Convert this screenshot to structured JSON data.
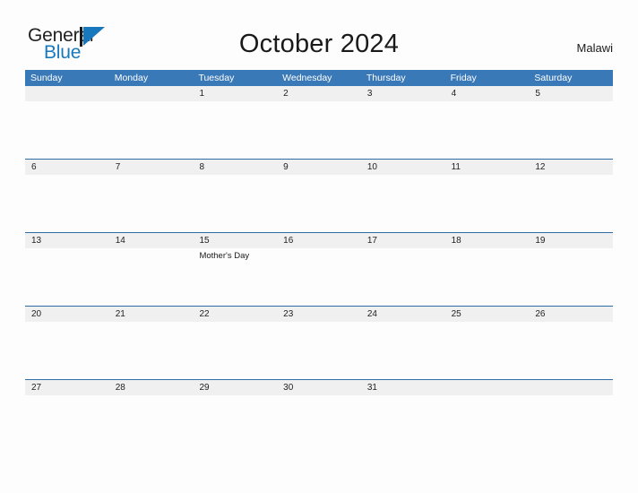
{
  "brand": {
    "name_part1": "General",
    "name_part2": "Blue",
    "logo_icon": "flag-triangle-icon",
    "accent_color": "#1878be"
  },
  "header": {
    "title": "October 2024",
    "country": "Malawi"
  },
  "colors": {
    "weekday_header_bg": "#3a79b8",
    "weekday_header_text": "#ffffff",
    "row_separator": "#2e6da4",
    "date_strip_bg": "#f0f0f0",
    "page_bg": "#fdfdfd",
    "text": "#222222"
  },
  "calendar": {
    "weekdays": [
      "Sunday",
      "Monday",
      "Tuesday",
      "Wednesday",
      "Thursday",
      "Friday",
      "Saturday"
    ],
    "weeks": [
      {
        "days": [
          {
            "num": "",
            "events": []
          },
          {
            "num": "",
            "events": []
          },
          {
            "num": "1",
            "events": []
          },
          {
            "num": "2",
            "events": []
          },
          {
            "num": "3",
            "events": []
          },
          {
            "num": "4",
            "events": []
          },
          {
            "num": "5",
            "events": []
          }
        ]
      },
      {
        "days": [
          {
            "num": "6",
            "events": []
          },
          {
            "num": "7",
            "events": []
          },
          {
            "num": "8",
            "events": []
          },
          {
            "num": "9",
            "events": []
          },
          {
            "num": "10",
            "events": []
          },
          {
            "num": "11",
            "events": []
          },
          {
            "num": "12",
            "events": []
          }
        ]
      },
      {
        "days": [
          {
            "num": "13",
            "events": []
          },
          {
            "num": "14",
            "events": []
          },
          {
            "num": "15",
            "events": [
              "Mother's Day"
            ]
          },
          {
            "num": "16",
            "events": []
          },
          {
            "num": "17",
            "events": []
          },
          {
            "num": "18",
            "events": []
          },
          {
            "num": "19",
            "events": []
          }
        ]
      },
      {
        "days": [
          {
            "num": "20",
            "events": []
          },
          {
            "num": "21",
            "events": []
          },
          {
            "num": "22",
            "events": []
          },
          {
            "num": "23",
            "events": []
          },
          {
            "num": "24",
            "events": []
          },
          {
            "num": "25",
            "events": []
          },
          {
            "num": "26",
            "events": []
          }
        ]
      },
      {
        "days": [
          {
            "num": "27",
            "events": []
          },
          {
            "num": "28",
            "events": []
          },
          {
            "num": "29",
            "events": []
          },
          {
            "num": "30",
            "events": []
          },
          {
            "num": "31",
            "events": []
          },
          {
            "num": "",
            "events": []
          },
          {
            "num": "",
            "events": []
          }
        ]
      }
    ]
  }
}
